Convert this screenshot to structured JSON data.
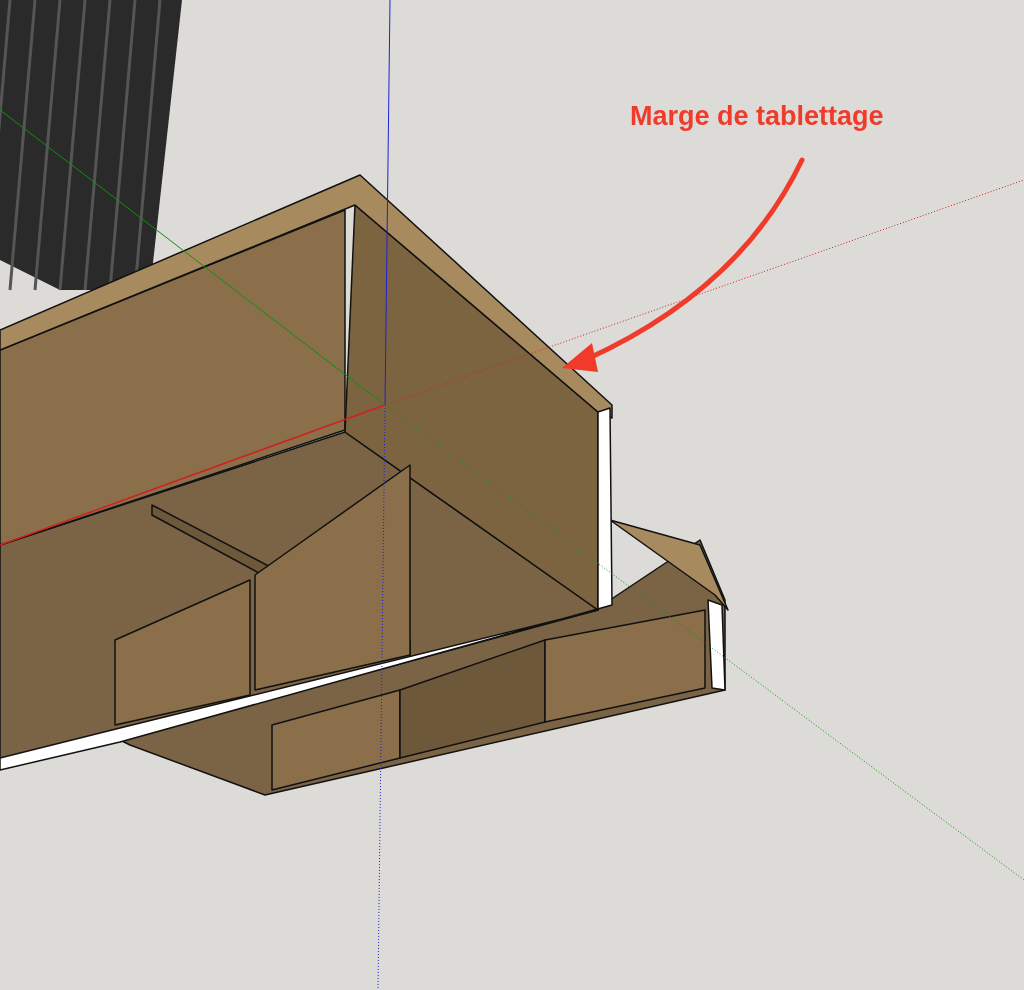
{
  "annotation": {
    "text": "Marge de tablettage"
  }
}
